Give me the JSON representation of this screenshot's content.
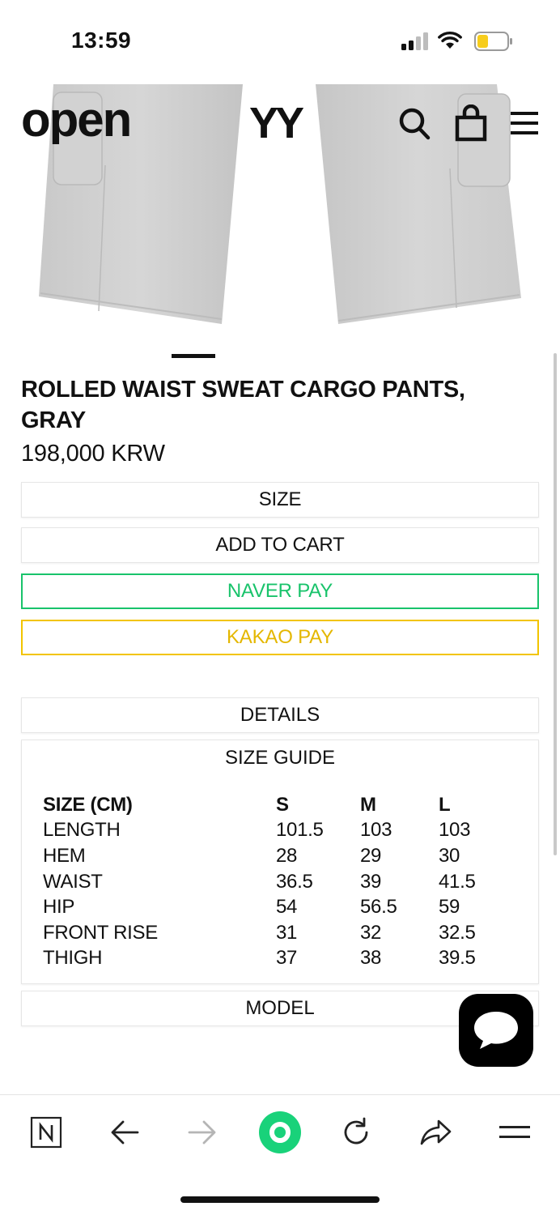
{
  "status_bar": {
    "time": "13:59"
  },
  "header": {
    "logo_left": "open",
    "logo_right": "YY",
    "icons": [
      "search-icon",
      "shopping-bag-icon",
      "hamburger-menu-icon"
    ]
  },
  "product": {
    "title": "ROLLED WAIST SWEAT CARGO PANTS, GRAY",
    "price": "198,000 KRW",
    "image_color": "#cfcfcf"
  },
  "actions": {
    "size_label": "SIZE",
    "add_to_cart_label": "ADD TO CART",
    "naver_pay_label": "NAVER PAY",
    "kakao_pay_label": "KAKAO PAY"
  },
  "sections": {
    "details_label": "DETAILS",
    "size_guide_label": "SIZE GUIDE",
    "model_label": "MODEL"
  },
  "size_guide": {
    "headers": [
      "SIZE (CM)",
      "S",
      "M",
      "L"
    ],
    "rows": [
      [
        "LENGTH",
        "101.5",
        "103",
        "103"
      ],
      [
        "HEM",
        "28",
        "29",
        "30"
      ],
      [
        "WAIST",
        "36.5",
        "39",
        "41.5"
      ],
      [
        "HIP",
        "54",
        "56.5",
        "59"
      ],
      [
        "FRONT RISE",
        "31",
        "32",
        "32.5"
      ],
      [
        "THIGH",
        "37",
        "38",
        "39.5"
      ]
    ]
  },
  "toolbar": {
    "icons": [
      "naver-n-icon",
      "back-arrow-icon",
      "forward-arrow-icon",
      "naver-home-icon",
      "reload-icon",
      "share-icon",
      "menu-icon"
    ]
  },
  "colors": {
    "naver_green": "#19c36b",
    "kakao_yellow": "#f2c400",
    "battery_yellow": "#f7cd1c"
  }
}
